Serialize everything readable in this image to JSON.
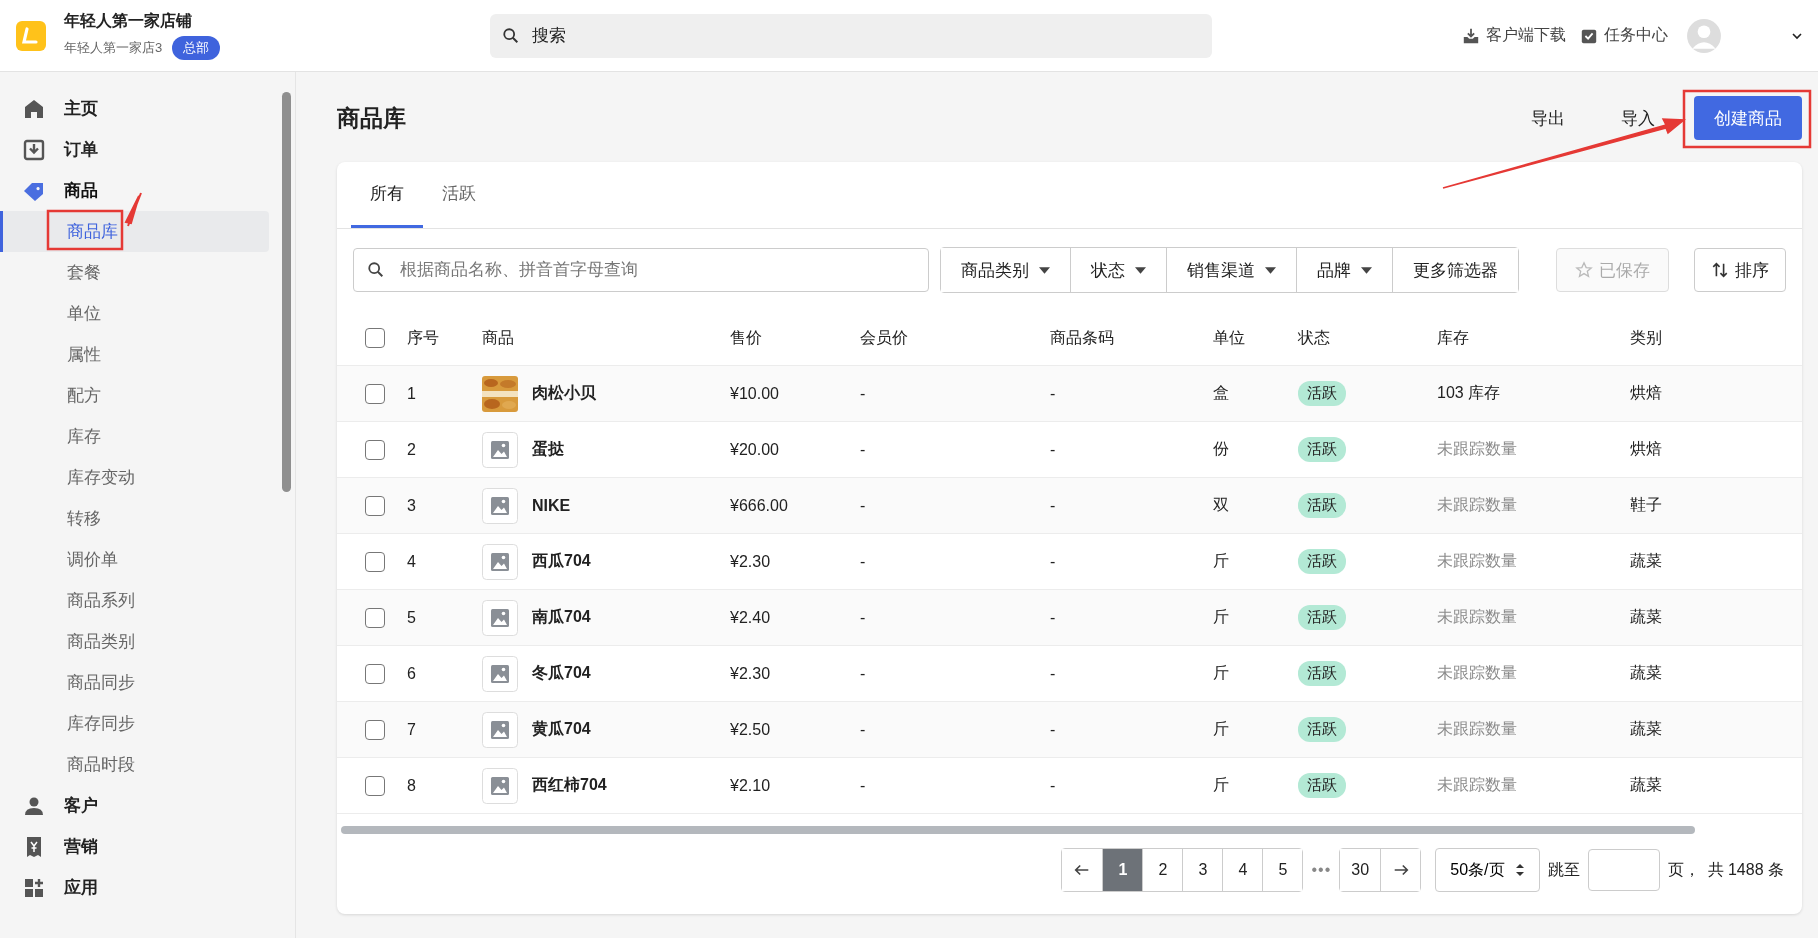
{
  "header": {
    "store_name": "年轻人第一家店铺",
    "store_sub": "年轻人第一家店3",
    "badge": "总部",
    "search_placeholder": "搜索",
    "actions": [
      {
        "label": "客户端下载"
      },
      {
        "label": "任务中心"
      }
    ]
  },
  "sidebar": {
    "items": [
      {
        "label": "主页"
      },
      {
        "label": "订单"
      },
      {
        "label": "商品",
        "expanded": true,
        "children": [
          {
            "label": "商品库",
            "selected": true
          },
          {
            "label": "套餐",
            "selected": false
          },
          {
            "label": "单位",
            "selected": false
          },
          {
            "label": "属性",
            "selected": false
          },
          {
            "label": "配方",
            "selected": false
          },
          {
            "label": "库存",
            "selected": false
          },
          {
            "label": "库存变动",
            "selected": false
          },
          {
            "label": "转移",
            "selected": false
          },
          {
            "label": "调价单",
            "selected": false
          },
          {
            "label": "商品系列",
            "selected": false
          },
          {
            "label": "商品类别",
            "selected": false
          },
          {
            "label": "商品同步",
            "selected": false
          },
          {
            "label": "库存同步",
            "selected": false
          },
          {
            "label": "商品时段",
            "selected": false
          }
        ]
      },
      {
        "label": "客户"
      },
      {
        "label": "营销"
      },
      {
        "label": "应用"
      }
    ]
  },
  "page": {
    "title": "商品库",
    "export": "导出",
    "import": "导入",
    "create": "创建商品"
  },
  "tabs": [
    {
      "label": "所有",
      "selected": true
    },
    {
      "label": "活跃",
      "selected": false
    }
  ],
  "filter": {
    "search_placeholder": "根据商品名称、拼音首字母查询",
    "dropdowns": [
      {
        "label": "商品类别",
        "kind": "dropdown"
      },
      {
        "label": "状态",
        "kind": "dropdown"
      },
      {
        "label": "销售渠道",
        "kind": "dropdown"
      },
      {
        "label": "品牌",
        "kind": "dropdown"
      },
      {
        "label": "更多筛选器",
        "kind": "button"
      }
    ],
    "saved": {
      "label": "已保存",
      "disabled": true
    },
    "sort": "排序"
  },
  "table": {
    "all_checked": false,
    "columns": [
      "序号",
      "商品",
      "售价",
      "会员价",
      "商品条码",
      "单位",
      "状态",
      "库存",
      "类别"
    ],
    "rows": [
      {
        "no": "1",
        "name": "肉松小贝",
        "price": "¥10.00",
        "member_price": "-",
        "barcode": "-",
        "unit": "盒",
        "status": "活跃",
        "stock": "103 库存",
        "stock_tracked": true,
        "category": "烘焙",
        "checked": false
      },
      {
        "no": "2",
        "name": "蛋挞",
        "price": "¥20.00",
        "member_price": "-",
        "barcode": "-",
        "unit": "份",
        "status": "活跃",
        "stock": "未跟踪数量",
        "stock_tracked": false,
        "category": "烘焙",
        "checked": false
      },
      {
        "no": "3",
        "name": "NIKE",
        "price": "¥666.00",
        "member_price": "-",
        "barcode": "-",
        "unit": "双",
        "status": "活跃",
        "stock": "未跟踪数量",
        "stock_tracked": false,
        "category": "鞋子",
        "checked": false
      },
      {
        "no": "4",
        "name": "西瓜704",
        "price": "¥2.30",
        "member_price": "-",
        "barcode": "-",
        "unit": "斤",
        "status": "活跃",
        "stock": "未跟踪数量",
        "stock_tracked": false,
        "category": "蔬菜",
        "checked": false
      },
      {
        "no": "5",
        "name": "南瓜704",
        "price": "¥2.40",
        "member_price": "-",
        "barcode": "-",
        "unit": "斤",
        "status": "活跃",
        "stock": "未跟踪数量",
        "stock_tracked": false,
        "category": "蔬菜",
        "checked": false
      },
      {
        "no": "6",
        "name": "冬瓜704",
        "price": "¥2.30",
        "member_price": "-",
        "barcode": "-",
        "unit": "斤",
        "status": "活跃",
        "stock": "未跟踪数量",
        "stock_tracked": false,
        "category": "蔬菜",
        "checked": false
      },
      {
        "no": "7",
        "name": "黄瓜704",
        "price": "¥2.50",
        "member_price": "-",
        "barcode": "-",
        "unit": "斤",
        "status": "活跃",
        "stock": "未跟踪数量",
        "stock_tracked": false,
        "category": "蔬菜",
        "checked": false
      },
      {
        "no": "8",
        "name": "西红柿704",
        "price": "¥2.10",
        "member_price": "-",
        "barcode": "-",
        "unit": "斤",
        "status": "活跃",
        "stock": "未跟踪数量",
        "stock_tracked": false,
        "category": "蔬菜",
        "checked": false
      }
    ]
  },
  "pagination": {
    "pages": [
      {
        "label": "1",
        "selected": true
      },
      {
        "label": "2",
        "selected": false
      },
      {
        "label": "3",
        "selected": false
      },
      {
        "label": "4",
        "selected": false
      },
      {
        "label": "5",
        "selected": false
      }
    ],
    "ellipsis": "•••",
    "last": "30",
    "page_size": "50条/页",
    "jump_label": "跳至",
    "page_unit": "页，",
    "total": "共 1488 条"
  }
}
